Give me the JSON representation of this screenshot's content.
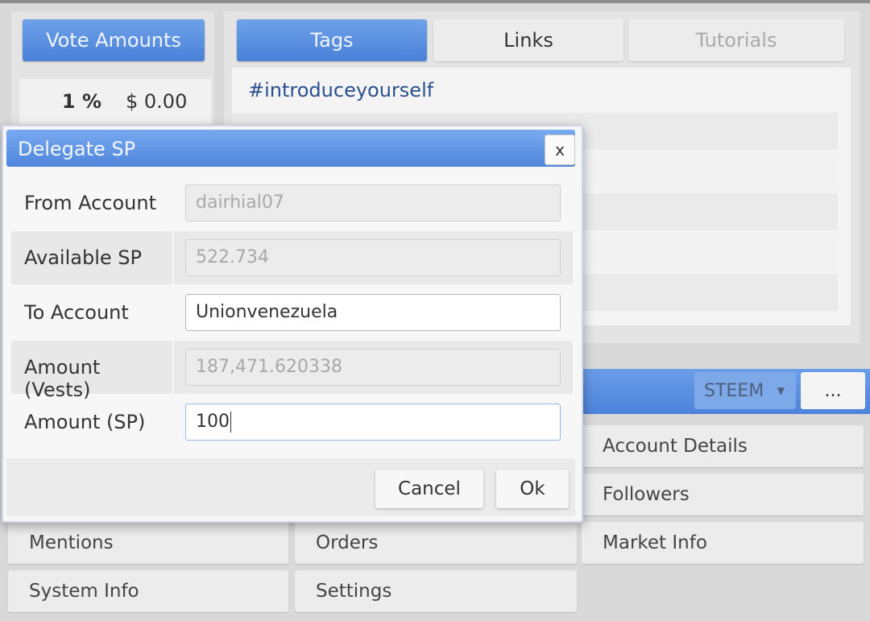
{
  "left_panel": {
    "tab_label": "Vote Amounts",
    "vote_percent": "1 %",
    "vote_value": "$ 0.00"
  },
  "tags_panel": {
    "tabs": [
      {
        "label": "Tags"
      },
      {
        "label": "Links"
      },
      {
        "label": "Tutorials"
      }
    ],
    "tags": [
      "#introduceyourself"
    ]
  },
  "toolbar": {
    "currency": "STEEM",
    "more_label": "..."
  },
  "menu": {
    "items": [
      {
        "label": "Account Details"
      },
      {
        "label": "Followers"
      },
      {
        "label": "Mentions"
      },
      {
        "label": "Orders"
      },
      {
        "label": "Market Info"
      },
      {
        "label": "System Info"
      },
      {
        "label": "Settings"
      }
    ]
  },
  "dialog": {
    "title": "Delegate SP",
    "close_label": "x",
    "fields": [
      {
        "label": "From Account",
        "value": "dairhial07"
      },
      {
        "label": "Available SP",
        "value": "522.734"
      },
      {
        "label": "To Account",
        "value": "Unionvenezuela"
      },
      {
        "label": "Amount (Vests)",
        "value": "187,471.620338"
      },
      {
        "label": "Amount (SP)",
        "value": "100"
      }
    ],
    "cancel_label": "Cancel",
    "ok_label": "Ok"
  },
  "colors": {
    "accent_blue": "#4f86dc",
    "tag_link": "#2a4f8f"
  }
}
